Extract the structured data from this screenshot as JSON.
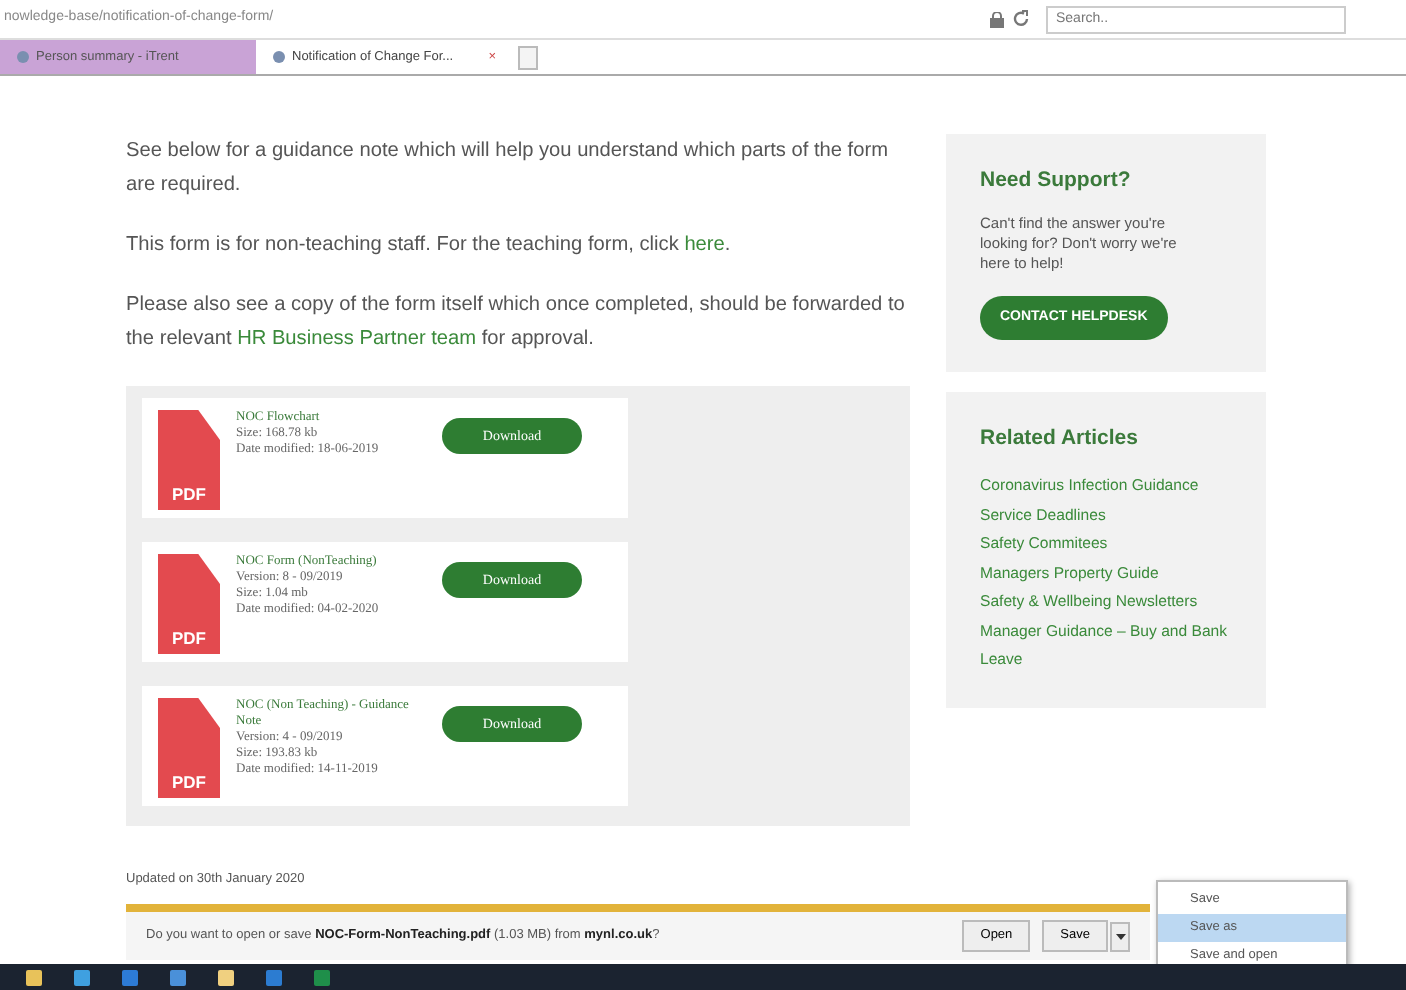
{
  "browser": {
    "address": "nowledge-base/notification-of-change-form/",
    "search_placeholder": "Search..",
    "tabs": [
      {
        "label": "Person summary - iTrent",
        "selected": false
      },
      {
        "label": "Notification of Change For...",
        "selected": true,
        "close": "×"
      }
    ]
  },
  "article": {
    "paragraphs": [
      [
        {
          "text": "See below for a guidance note which will help you understand which parts of the form are required."
        }
      ],
      [
        {
          "text": "This form is for non-teaching staff. For the teaching form, click "
        },
        {
          "text": "here",
          "link": true
        },
        {
          "text": "."
        }
      ],
      [
        {
          "text": "Please also see a copy of the form itself which once completed, should be forwarded to the relevant "
        },
        {
          "text": "HR Business Partner team",
          "link": true
        },
        {
          "text": " for approval."
        }
      ]
    ]
  },
  "files": [
    {
      "badge": "PDF",
      "title": "NOC Flowchart",
      "details": [
        "Size: 168.78 kb",
        "Date modified: 18-06-2019"
      ],
      "button": "Download"
    },
    {
      "badge": "PDF",
      "title": "NOC Form (NonTeaching)",
      "details": [
        "Version: 8 - 09/2019",
        "Size: 1.04 mb",
        "Date modified: 04-02-2020"
      ],
      "button": "Download"
    },
    {
      "badge": "PDF",
      "title": "NOC (Non Teaching) - Guidance Note",
      "details": [
        "Version: 4 - 09/2019",
        "Size: 193.83 kb",
        "Date modified: 14-11-2019"
      ],
      "button": "Download"
    }
  ],
  "support": {
    "title": "Need Support?",
    "text": "Can't find the answer you're looking for? Don't worry we're here to help!",
    "button": "CONTACT HELPDESK"
  },
  "related": {
    "title": "Related Articles",
    "links": [
      "Coronavirus Infection Guidance",
      "Service Deadlines",
      "Safety Commitees",
      "Managers Property Guide",
      "Safety & Wellbeing Newsletters",
      "Manager Guidance – Buy and Bank Leave"
    ]
  },
  "updated": "Updated on 30th January 2020",
  "download_bar": {
    "message": "Do you want to open or save **NOC-Form-NonTeaching.pdf** (1.03 MB) from **mynl.co.uk**?",
    "buttons": [
      "Open",
      "Save"
    ]
  },
  "save_menu": [
    {
      "label": "Save",
      "selected": false
    },
    {
      "label": "Save as",
      "selected": true
    },
    {
      "label": "Save and open",
      "selected": false
    }
  ]
}
